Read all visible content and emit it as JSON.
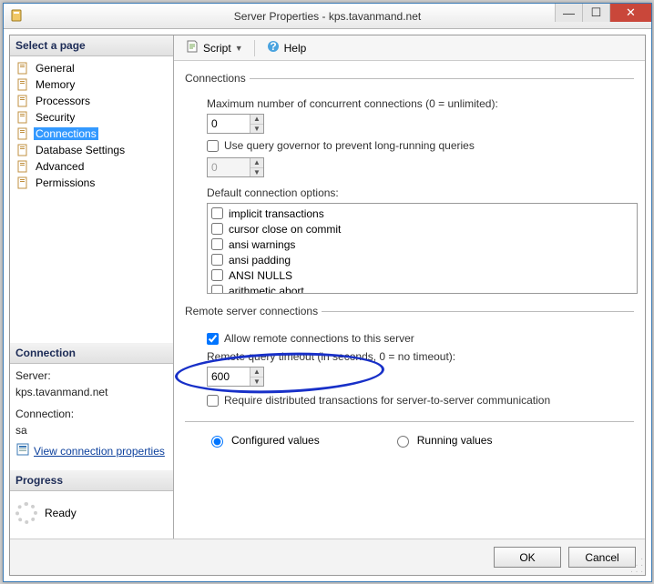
{
  "window": {
    "title": "Server Properties - kps.tavanmand.net"
  },
  "toolbar": {
    "script": "Script",
    "help": "Help"
  },
  "sidebar": {
    "header": "Select a page",
    "items": [
      {
        "label": "General"
      },
      {
        "label": "Memory"
      },
      {
        "label": "Processors"
      },
      {
        "label": "Security"
      },
      {
        "label": "Connections",
        "selected": true
      },
      {
        "label": "Database Settings"
      },
      {
        "label": "Advanced"
      },
      {
        "label": "Permissions"
      }
    ]
  },
  "connection_panel": {
    "header": "Connection",
    "server_lbl": "Server:",
    "server_val": "kps.tavanmand.net",
    "conn_lbl": "Connection:",
    "conn_val": "sa",
    "view_props": "View connection properties"
  },
  "progress_panel": {
    "header": "Progress",
    "status": "Ready"
  },
  "page": {
    "connections_legend": "Connections",
    "max_conn_lbl": "Maximum number of concurrent connections (0 = unlimited):",
    "max_conn_val": "0",
    "use_governor": "Use query governor to prevent long-running queries",
    "governor_val": "0",
    "default_opts_lbl": "Default connection options:",
    "options": [
      "implicit transactions",
      "cursor close on commit",
      "ansi warnings",
      "ansi padding",
      "ANSI NULLS",
      "arithmetic abort"
    ],
    "remote_legend": "Remote server connections",
    "allow_remote": "Allow remote connections to this server",
    "remote_timeout_lbl": "Remote query timeout (in seconds, 0 = no timeout):",
    "remote_timeout_val": "600",
    "require_dist": "Require distributed transactions for server-to-server communication",
    "configured": "Configured values",
    "running": "Running values"
  },
  "buttons": {
    "ok": "OK",
    "cancel": "Cancel"
  }
}
